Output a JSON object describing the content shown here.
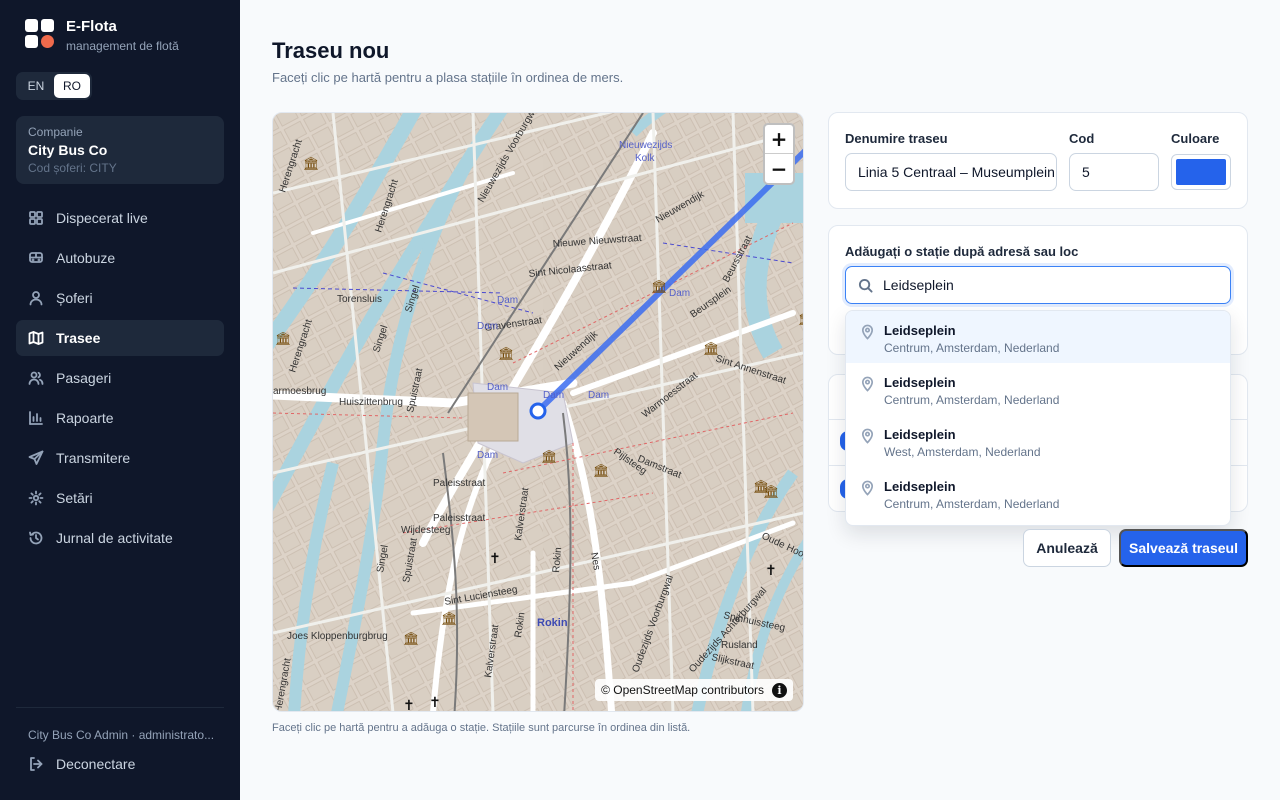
{
  "brand": {
    "name": "E-Flota",
    "subtitle": "management de flotă"
  },
  "lang": {
    "en": "EN",
    "ro": "RO",
    "active": "RO"
  },
  "company": {
    "label": "Companie",
    "name": "City Bus Co",
    "code": "Cod șoferi: CITY"
  },
  "nav": [
    {
      "label": "Dispecerat live",
      "icon": "dashboard-icon"
    },
    {
      "label": "Autobuze",
      "icon": "bus-icon"
    },
    {
      "label": "Șoferi",
      "icon": "user-icon"
    },
    {
      "label": "Trasee",
      "icon": "map-icon",
      "active": true
    },
    {
      "label": "Pasageri",
      "icon": "users-icon"
    },
    {
      "label": "Rapoarte",
      "icon": "chart-icon"
    },
    {
      "label": "Transmitere",
      "icon": "send-icon"
    },
    {
      "label": "Setări",
      "icon": "gear-icon"
    },
    {
      "label": "Jurnal de activitate",
      "icon": "history-icon"
    }
  ],
  "footer": {
    "user": "City Bus Co Admin · administrato...",
    "logout": "Deconectare"
  },
  "page": {
    "title": "Traseu nou",
    "subtitle": "Faceți clic pe hartă pentru a plasa stațiile în ordinea de mers."
  },
  "map": {
    "zoom_in": "+",
    "zoom_out": "−",
    "attribution": "© OpenStreetMap contributors",
    "info": "i",
    "hint": "Faceți clic pe hartă pentru a adăuga o stație. Stațiile sunt parcurse în ordinea din listă.",
    "labels": {
      "dam": "Dam",
      "gravenstraat": "Gravenstraat",
      "torensluis": "Torensluis",
      "huiszittenbrug": "Huiszittenbrug",
      "nieuwezijds_kolk": "Nieuwezijds",
      "kolk": "Kolk",
      "sint_nicolaasstraat": "Sint Nicolaasstraat",
      "nieuwe_nieuwstraat": "Nieuwe Nieuwstraat",
      "nieuwendijk": "Nieuwendijk",
      "damrak": "Damrak",
      "beursplein": "Beursplein",
      "beursstraat": "Beursstraat",
      "sint_annenstraat": "Sint Annenstraat",
      "warmoesstraat": "Warmoesstraat",
      "paleisstraat": "Paleisstraat",
      "wijdesteeg": "Wijdesteeg",
      "kalverstraat": "Kalverstraat",
      "sint_luciensteeg": "Sint Luciensteeg",
      "joes_kloppenburgbrug": "Joes Kloppenburgbrug",
      "rokin": "Rokin",
      "singel": "Singel",
      "spuistraat": "Spuistraat",
      "herengracht": "Herengracht",
      "pijlsteeg": "Pijlsteeg",
      "damstraat": "Damstraat",
      "oudezijds_voorburgwal": "Oudezijds Voorburgwal",
      "oudezijds_achterburgwal": "Oudezijds Achterburgwal",
      "spinhuissteeg": "Spinhuissteeg",
      "rusland": "Rusland",
      "slijkstraat": "Slijkstraat",
      "oude_hoog": "Oude Hoog",
      "nes": "Nes",
      "warmoesbrug": "armoesbrug",
      "nieuwezijds_voorburgwal": "Nieuwezijds Voorburgwal"
    }
  },
  "form": {
    "name_label": "Denumire traseu",
    "name_value": "Linia 5 Centraal – Museumplein",
    "code_label": "Cod",
    "code_value": "5",
    "color_label": "Culoare",
    "color_value": "#2563eb"
  },
  "search": {
    "label": "Adăugați o stație după adresă sau loc",
    "value": "Leidseplein",
    "results": [
      {
        "name": "Leidseplein",
        "sub": "Centrum, Amsterdam, Nederland"
      },
      {
        "name": "Leidseplein",
        "sub": "Centrum, Amsterdam, Nederland"
      },
      {
        "name": "Leidseplein",
        "sub": "West, Amsterdam, Nederland"
      },
      {
        "name": "Leidseplein",
        "sub": "Centrum, Amsterdam, Nederland"
      }
    ]
  },
  "actions": {
    "cancel": "Anulează",
    "save": "Salvează traseul"
  },
  "colors": {
    "sidebar": "#0f172a",
    "accent": "#2563eb",
    "route": "#3b6cf0"
  }
}
